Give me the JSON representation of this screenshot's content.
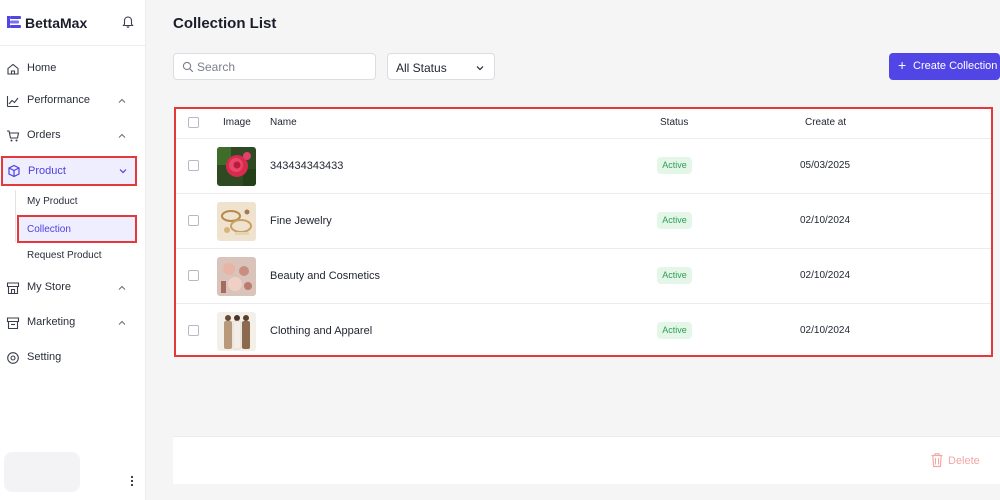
{
  "brand": {
    "name": "BettaMax"
  },
  "sidebar": {
    "items": [
      {
        "label": "Home",
        "icon": "home-icon"
      },
      {
        "label": "Performance",
        "icon": "chart-icon"
      },
      {
        "label": "Orders",
        "icon": "cart-icon"
      },
      {
        "label": "Product",
        "icon": "box-icon",
        "active": true
      },
      {
        "label": "My Store",
        "icon": "store-icon"
      },
      {
        "label": "Marketing",
        "icon": "megaphone-icon"
      },
      {
        "label": "Setting",
        "icon": "gear-icon"
      }
    ],
    "product_sub": [
      {
        "label": "My Product"
      },
      {
        "label": "Collection",
        "active": true
      },
      {
        "label": "Request Product"
      }
    ]
  },
  "page": {
    "title": "Collection List"
  },
  "toolbar": {
    "search_placeholder": "Search",
    "status_value": "All Status",
    "create_label": "Create Collection",
    "create_plus": "+"
  },
  "table": {
    "headers": {
      "image": "Image",
      "name": "Name",
      "status": "Status",
      "created": "Create at"
    },
    "rows": [
      {
        "name": "343434343433",
        "status": "Active",
        "created": "05/03/2025",
        "thumb": "rose-photo"
      },
      {
        "name": "Fine Jewelry",
        "status": "Active",
        "created": "02/10/2024",
        "thumb": "jewelry-photo"
      },
      {
        "name": "Beauty and Cosmetics",
        "status": "Active",
        "created": "02/10/2024",
        "thumb": "cosmetics-photo"
      },
      {
        "name": "Clothing and Apparel",
        "status": "Active",
        "created": "02/10/2024",
        "thumb": "apparel-photo"
      }
    ]
  },
  "footer": {
    "delete_label": "Delete"
  },
  "colors": {
    "accent": "#5145e6",
    "highlight": "#e5383b",
    "active_badge": "#2f9e55"
  }
}
